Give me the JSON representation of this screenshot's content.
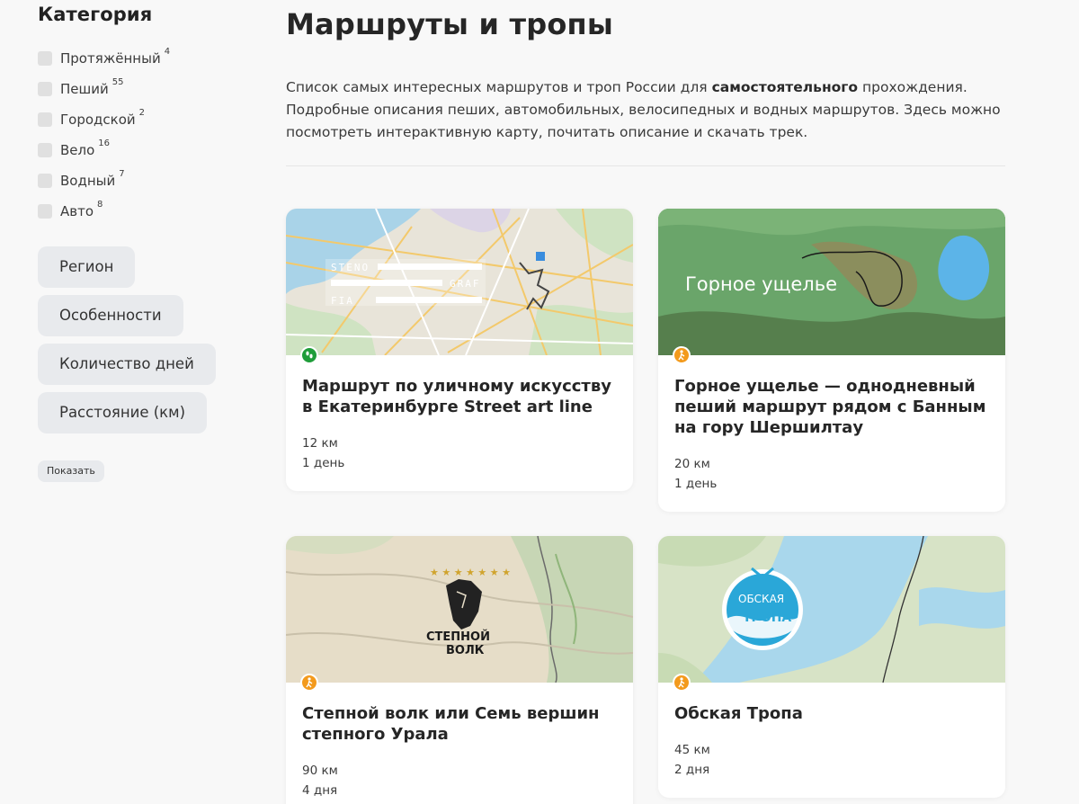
{
  "sidebar": {
    "category_title": "Категория",
    "categories": [
      {
        "label": "Протяжённый",
        "count": "4"
      },
      {
        "label": "Пеший",
        "count": "55"
      },
      {
        "label": "Городской",
        "count": "2"
      },
      {
        "label": "Вело",
        "count": "16"
      },
      {
        "label": "Водный",
        "count": "7"
      },
      {
        "label": "Авто",
        "count": "8"
      }
    ],
    "filters": [
      "Регион",
      "Особенности",
      "Количество дней",
      "Расстояние (км)"
    ],
    "show_label": "Показать"
  },
  "main": {
    "title": "Маршруты и тропы",
    "intro_before": "Список самых интересных маршрутов и троп России для ",
    "intro_bold": "самостоятельного",
    "intro_after": " прохождения. Подробные описания пеших, автомобильных, велосипедных и водных маршрутов. Здесь можно посмотреть интерактивную карту, почитать описание и скачать трек."
  },
  "cards": [
    {
      "title": "Маршрут по уличному искусству в Екатеринбурге Street art line",
      "distance": "12 км",
      "days": "1 день",
      "icon": "footprints-icon",
      "icon_color": "#1f9d3a",
      "image_text": [
        "STENO",
        "GRAF",
        "FIA"
      ]
    },
    {
      "title": "Горное ущелье — однодневный пеший маршрут рядом с Банным на гору Шершилтау",
      "distance": "20 км",
      "days": "1 день",
      "icon": "hiker-icon",
      "icon_color": "#f39a1c",
      "image_text": [
        "Горное ущелье"
      ]
    },
    {
      "title": "Степной волк или Семь вершин степного Урала",
      "distance": "90 км",
      "days": "4 дня",
      "icon": "hiker-icon",
      "icon_color": "#f39a1c",
      "image_text": [
        "СТЕПНОЙ",
        "ВОЛК"
      ]
    },
    {
      "title": "Обская Тропа",
      "distance": "45 км",
      "days": "2 дня",
      "icon": "hiker-icon",
      "icon_color": "#f39a1c",
      "image_text": [
        "ОБСКАЯ",
        "ТРОПА"
      ]
    }
  ]
}
